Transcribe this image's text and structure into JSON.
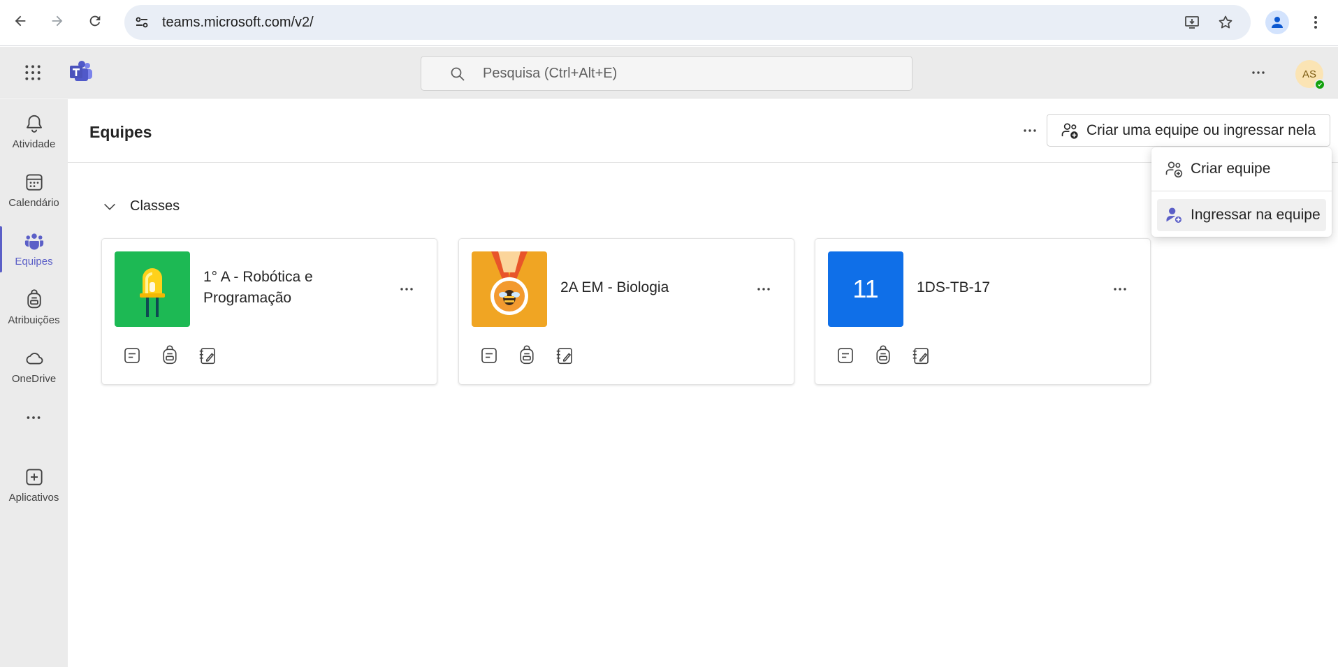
{
  "browser": {
    "url": "teams.microsoft.com/v2/"
  },
  "teams_bar": {
    "search_placeholder": "Pesquisa (Ctrl+Alt+E)",
    "avatar_initials": "AS"
  },
  "rail": {
    "items": [
      {
        "label": "Atividade",
        "icon": "bell-icon"
      },
      {
        "label": "Calendário",
        "icon": "calendar-icon"
      },
      {
        "label": "Equipes",
        "icon": "teams-icon",
        "active": true
      },
      {
        "label": "Atribuições",
        "icon": "backpack-icon"
      },
      {
        "label": "OneDrive",
        "icon": "cloud-icon"
      },
      {
        "label": "Aplicativos",
        "icon": "add-app-icon"
      }
    ]
  },
  "page": {
    "title": "Equipes",
    "create_join_label": "Criar uma equipe ou ingressar nela",
    "section_title": "Classes"
  },
  "cards": [
    {
      "name": "1° A - Robótica e Programação",
      "thumb_color": "#1db954",
      "thumb_icon": "led-icon"
    },
    {
      "name": "2A EM - Biologia",
      "thumb_color": "#f0a523",
      "thumb_icon": "medal-icon"
    },
    {
      "name": "1DS-TB-17",
      "thumb_color": "#0f6fe8",
      "thumb_text": "11"
    }
  ],
  "menu": {
    "items": [
      {
        "label": "Criar equipe",
        "icon": "create-team-icon"
      },
      {
        "label": "Ingressar na equipe",
        "icon": "join-team-icon"
      }
    ]
  },
  "colors": {
    "brand": "#5b5fc7",
    "rail_bg": "#ebebeb"
  }
}
